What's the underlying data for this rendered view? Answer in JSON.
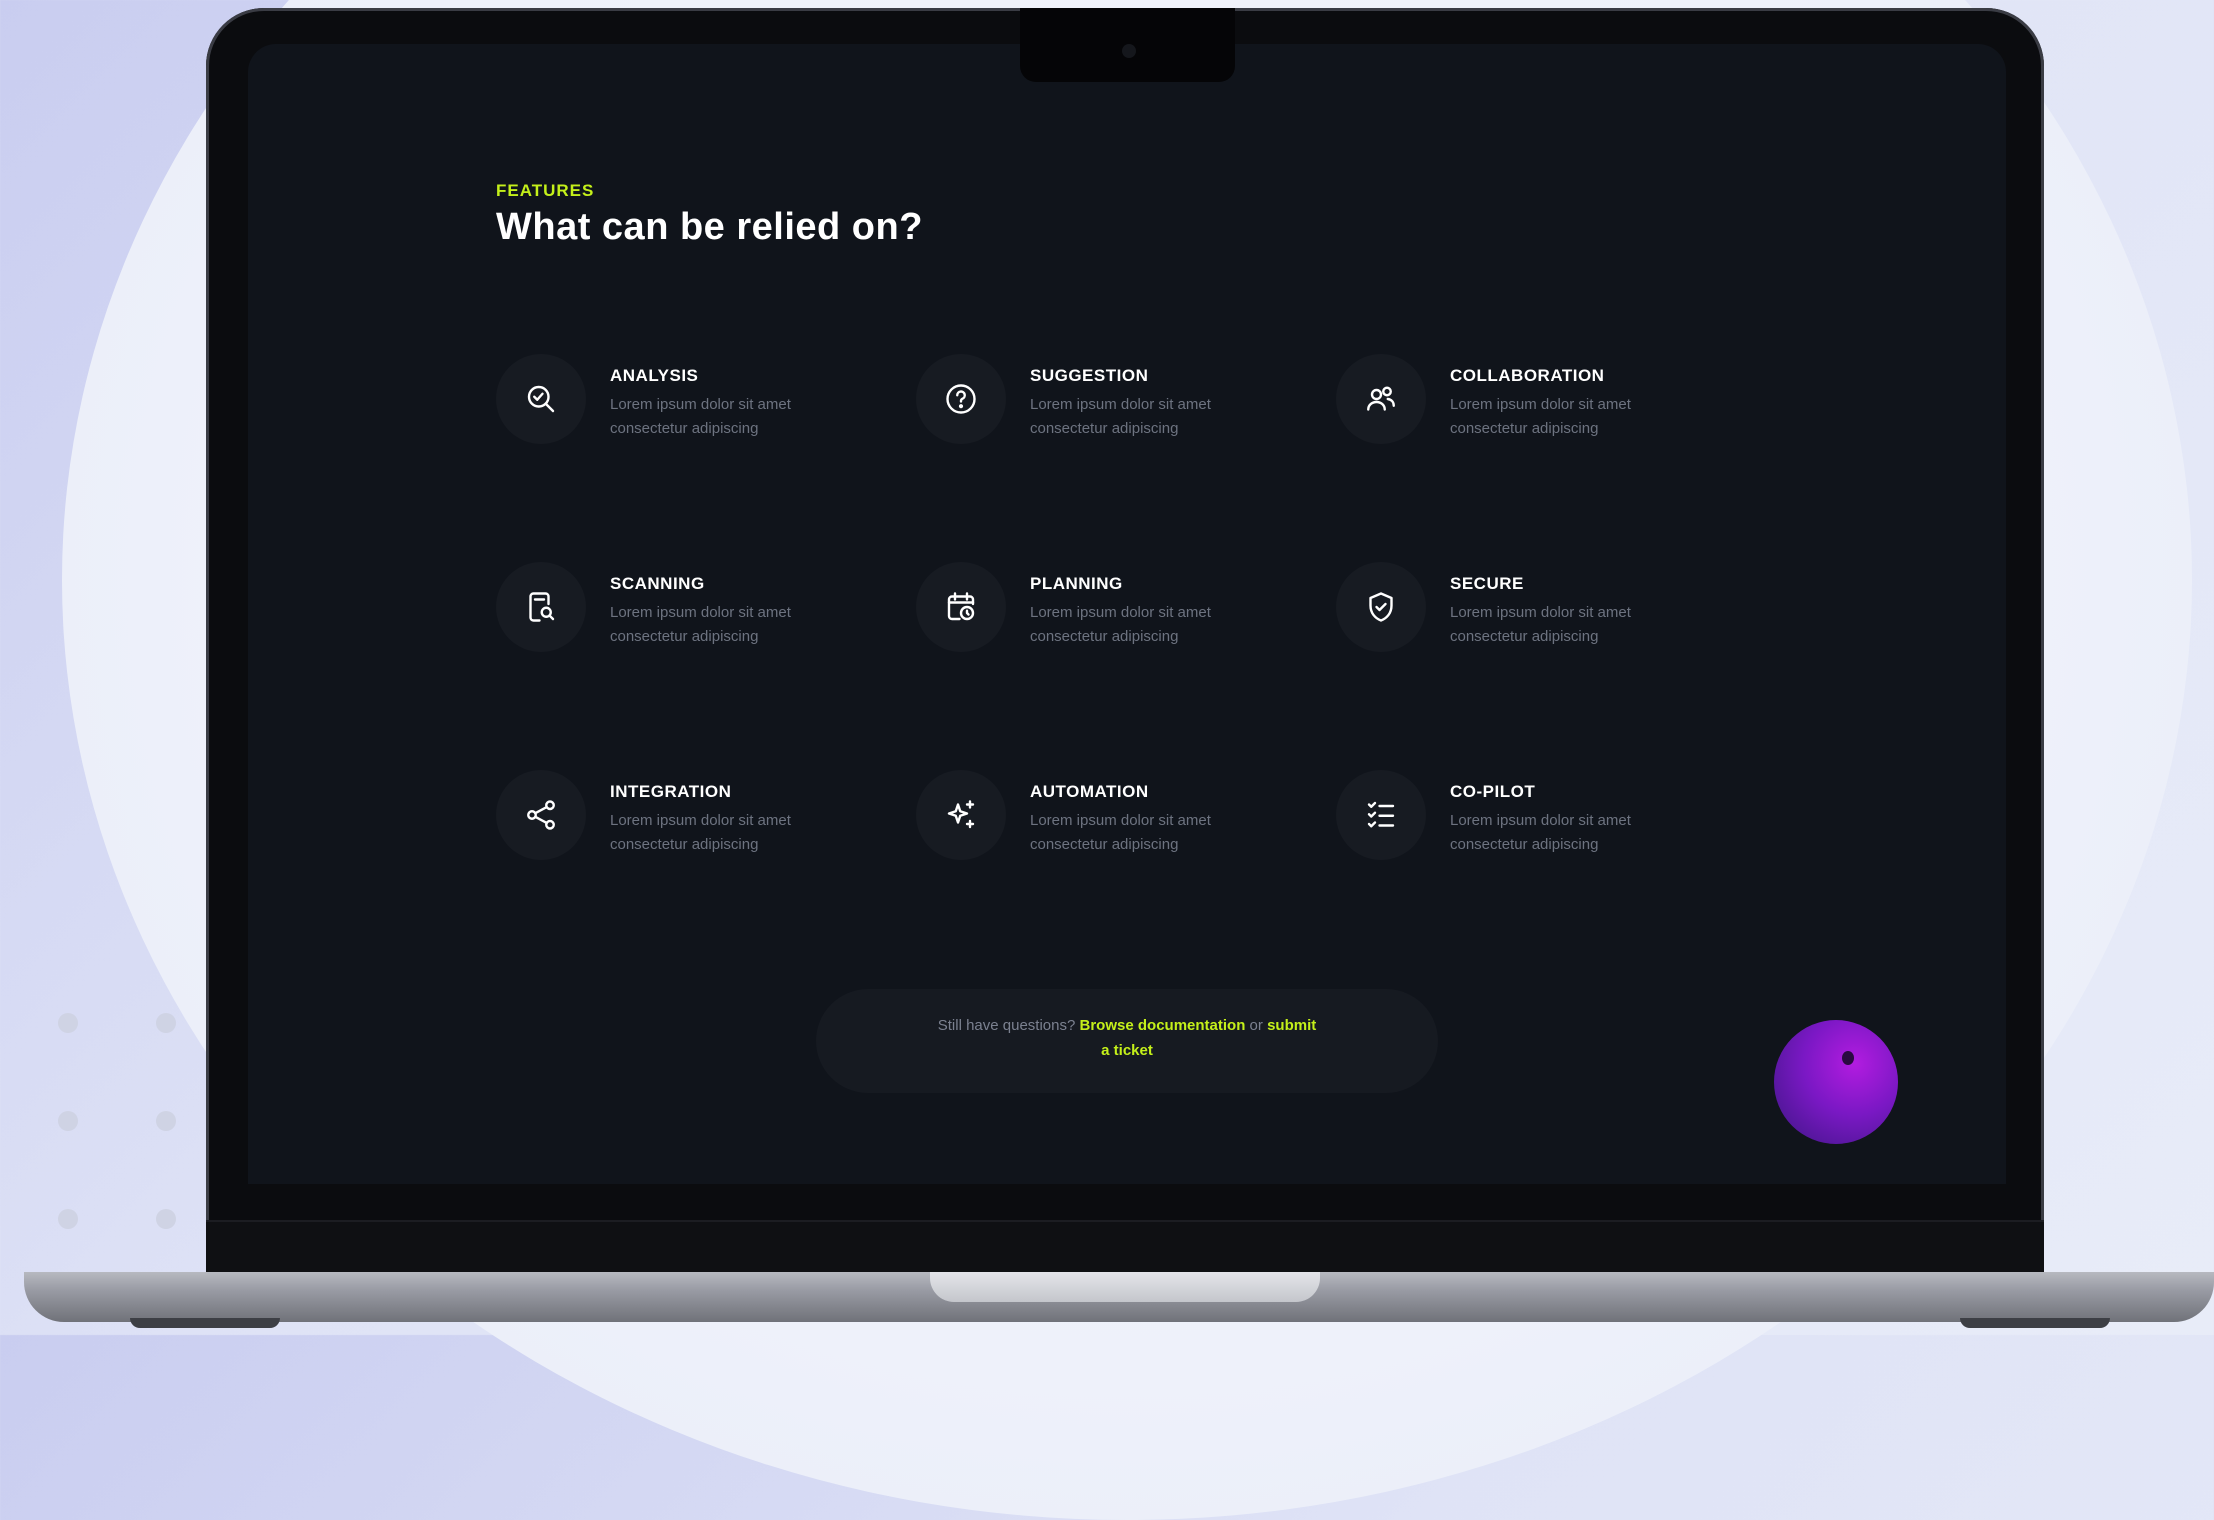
{
  "section": {
    "eyebrow": "FEATURES",
    "title": "What can be relied on?"
  },
  "features": [
    {
      "title": "ANALYSIS",
      "description": "Lorem ipsum dolor sit amet consectetur adipiscing",
      "icon": "search-analysis-icon"
    },
    {
      "title": "SUGGESTION",
      "description": "Lorem ipsum dolor sit amet consectetur adipiscing",
      "icon": "question-circle-icon"
    },
    {
      "title": "COLLABORATION",
      "description": "Lorem ipsum dolor sit amet consectetur adipiscing",
      "icon": "users-icon"
    },
    {
      "title": "SCANNING",
      "description": "Lorem ipsum dolor sit amet consectetur adipiscing",
      "icon": "document-search-icon"
    },
    {
      "title": "PLANNING",
      "description": "Lorem ipsum dolor sit amet consectetur adipiscing",
      "icon": "calendar-clock-icon"
    },
    {
      "title": "SECURE",
      "description": "Lorem ipsum dolor sit amet consectetur adipiscing",
      "icon": "shield-check-icon"
    },
    {
      "title": "INTEGRATION",
      "description": "Lorem ipsum dolor sit amet consectetur adipiscing",
      "icon": "share-nodes-icon"
    },
    {
      "title": "AUTOMATION",
      "description": "Lorem ipsum dolor sit amet consectetur adipiscing",
      "icon": "sparkles-icon"
    },
    {
      "title": "CO-PILOT",
      "description": "Lorem ipsum dolor sit amet consectetur adipiscing",
      "icon": "checklist-icon"
    }
  ],
  "cta": {
    "prefix": "Still have questions?",
    "docs_link": "Browse documentation",
    "middle": "or",
    "ticket_link": "submit a ticket"
  },
  "colors": {
    "accent": "#c4f01a",
    "screen_bg": "#10141b",
    "orb": "#8a1ad0"
  }
}
